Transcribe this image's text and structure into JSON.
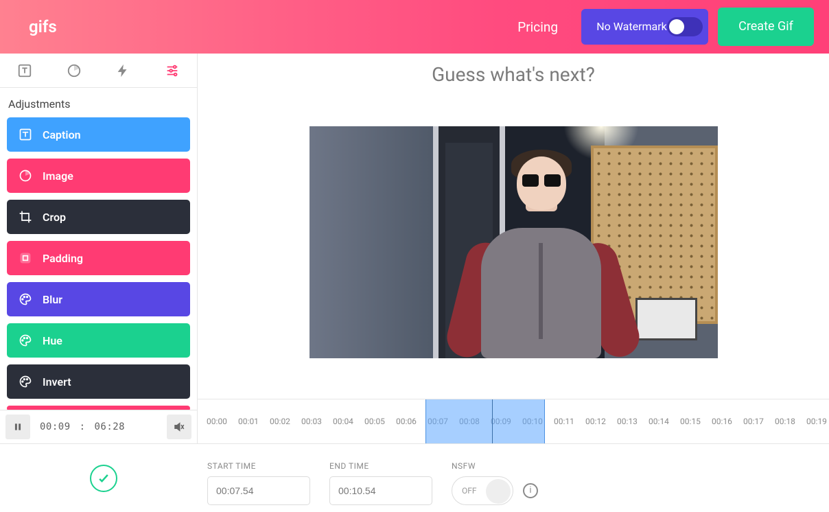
{
  "header": {
    "logo": "gifs",
    "pricing_label": "Pricing",
    "no_watermark_label": "No Watermark",
    "no_watermark_on": false,
    "create_label": "Create Gif"
  },
  "sidebar": {
    "section_title": "Adjustments",
    "items": [
      {
        "icon": "caption-icon",
        "label": "Caption",
        "color": "c-blue"
      },
      {
        "icon": "image-icon",
        "label": "Image",
        "color": "c-pink"
      },
      {
        "icon": "crop-icon",
        "label": "Crop",
        "color": "c-dark"
      },
      {
        "icon": "padding-icon",
        "label": "Padding",
        "color": "c-pink"
      },
      {
        "icon": "blur-icon",
        "label": "Blur",
        "color": "c-purple"
      },
      {
        "icon": "hue-icon",
        "label": "Hue",
        "color": "c-green"
      },
      {
        "icon": "invert-icon",
        "label": "Invert",
        "color": "c-dark"
      }
    ]
  },
  "tabs": [
    {
      "name": "text-tab",
      "active": false
    },
    {
      "name": "timer-tab",
      "active": false
    },
    {
      "name": "effects-tab",
      "active": false
    },
    {
      "name": "sliders-tab",
      "active": true
    }
  ],
  "playbar": {
    "current": "00:09",
    "sep": ":",
    "total": "06:28"
  },
  "preview": {
    "title": "Guess what's next?"
  },
  "timeline": {
    "ticks": [
      "00:00",
      "00:01",
      "00:02",
      "00:03",
      "00:04",
      "00:05",
      "00:06",
      "00:07",
      "00:08",
      "00:09",
      "00:10",
      "00:11",
      "00:12",
      "00:13",
      "00:14",
      "00:15",
      "00:16",
      "00:17",
      "00:18",
      "00:19"
    ],
    "selection_start_index": 7,
    "selection_end_index": 10
  },
  "controls": {
    "start_label": "START TIME",
    "start_value": "00:07.54",
    "end_label": "END TIME",
    "end_value": "00:10.54",
    "nsfw_label": "NSFW",
    "nsfw_value": "OFF"
  }
}
